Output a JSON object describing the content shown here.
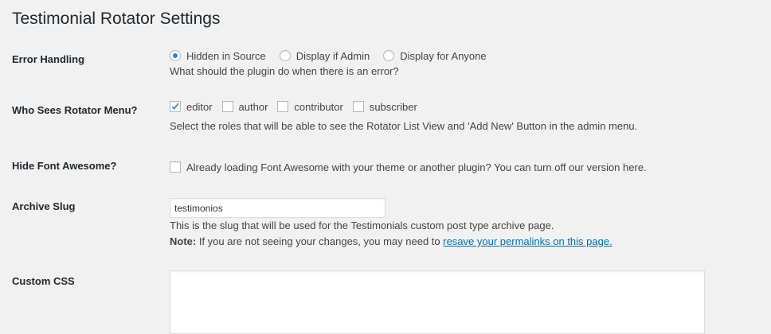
{
  "page": {
    "title": "Testimonial Rotator Settings"
  },
  "error_handling": {
    "label": "Error Handling",
    "options": [
      {
        "label": "Hidden in Source",
        "selected": true
      },
      {
        "label": "Display if Admin",
        "selected": false
      },
      {
        "label": "Display for Anyone",
        "selected": false
      }
    ],
    "description": "What should the plugin do when there is an error?"
  },
  "rotator_menu": {
    "label": "Who Sees Rotator Menu?",
    "roles": [
      {
        "label": "editor",
        "checked": true
      },
      {
        "label": "author",
        "checked": false
      },
      {
        "label": "contributor",
        "checked": false
      },
      {
        "label": "subscriber",
        "checked": false
      }
    ],
    "description": "Select the roles that will be able to see the Rotator List View and 'Add New' Button in the admin menu."
  },
  "hide_font_awesome": {
    "label": "Hide Font Awesome?",
    "checked": false,
    "option_label": "Already loading Font Awesome with your theme or another plugin? You can turn off our version here."
  },
  "archive_slug": {
    "label": "Archive Slug",
    "value": "testimonios",
    "description": "This is the slug that will be used for the Testimonials custom post type archive page.",
    "note_prefix": "Note:",
    "note_text": " If you are not seeing your changes, you may need to ",
    "note_link": "resave your permalinks on this page."
  },
  "custom_css": {
    "label": "Custom CSS",
    "value": ""
  },
  "colors": {
    "background": "#f1f1f1",
    "accent": "#1e8cbe",
    "link": "#0073aa"
  }
}
